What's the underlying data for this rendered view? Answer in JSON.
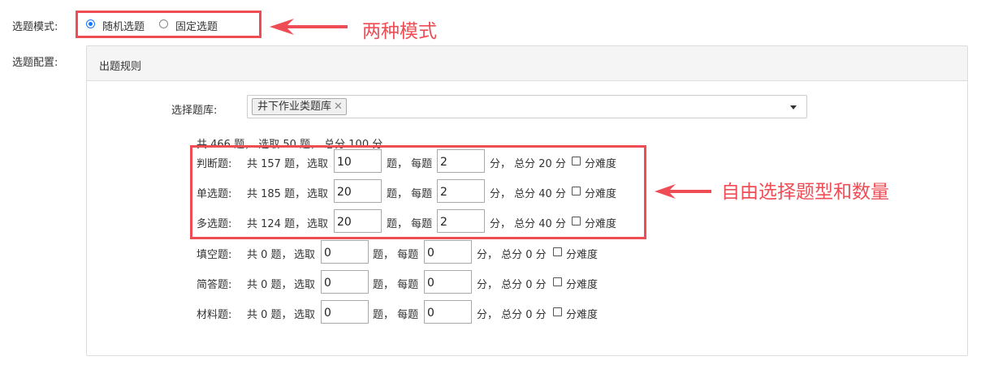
{
  "mode": {
    "label": "选题模式:",
    "options": [
      {
        "label": "随机选题",
        "selected": true
      },
      {
        "label": "固定选题",
        "selected": false
      }
    ]
  },
  "config": {
    "label": "选题配置:",
    "panel_title": "出题规则",
    "bank_label": "选择题库:",
    "bank_tag": "井下作业类题库",
    "summary": "共 466 题， 选取 50 题， 总分 100 分",
    "rows": [
      {
        "type": "判断题:",
        "total": "共 157 题，",
        "select_label": "选取",
        "select_value": "10",
        "per_label": "题， 每题",
        "per_value": "2",
        "score": "分， 总分 20 分",
        "difficulty": "分难度"
      },
      {
        "type": "单选题:",
        "total": "共 185 题，",
        "select_label": "选取",
        "select_value": "20",
        "per_label": "题， 每题",
        "per_value": "2",
        "score": "分， 总分 40 分",
        "difficulty": "分难度"
      },
      {
        "type": "多选题:",
        "total": "共 124 题，",
        "select_label": "选取",
        "select_value": "20",
        "per_label": "题， 每题",
        "per_value": "2",
        "score": "分， 总分 40 分",
        "difficulty": "分难度"
      },
      {
        "type": "填空题:",
        "total": "共 0 题，",
        "select_label": "选取",
        "select_value": "0",
        "per_label": "题， 每题",
        "per_value": "0",
        "score": "分， 总分 0 分",
        "difficulty": "分难度"
      },
      {
        "type": "简答题:",
        "total": "共 0 题，",
        "select_label": "选取",
        "select_value": "0",
        "per_label": "题， 每题",
        "per_value": "0",
        "score": "分， 总分 0 分",
        "difficulty": "分难度"
      },
      {
        "type": "材料题:",
        "total": "共 0 题，",
        "select_label": "选取",
        "select_value": "0",
        "per_label": "题， 每题",
        "per_value": "0",
        "score": "分， 总分 0 分",
        "difficulty": "分难度"
      }
    ]
  },
  "annotations": {
    "mode_note": "两种模式",
    "rows_note": "自由选择题型和数量",
    "color": "#ef4d55"
  },
  "icons": {
    "remove_tag": "close-icon",
    "dropdown": "caret-down-icon",
    "arrow": "arrow-left-icon"
  }
}
